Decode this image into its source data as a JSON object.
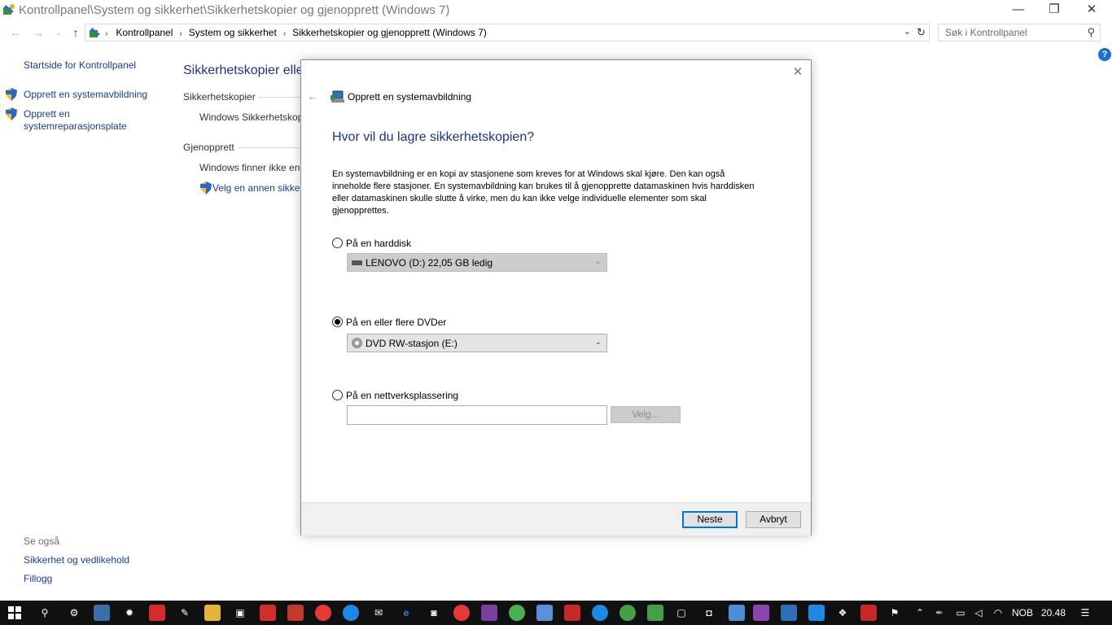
{
  "window": {
    "title": "Kontrollpanel\\System og sikkerhet\\Sikkerhetskopier og gjenopprett (Windows 7)",
    "minimize": "—",
    "maximize": "❐",
    "close": "✕"
  },
  "address": {
    "crumbs": [
      "Kontrollpanel",
      "System og sikkerhet",
      "Sikkerhetskopier og gjenopprett (Windows 7)"
    ],
    "search_placeholder": "Søk i Kontrollpanel"
  },
  "sidebar": {
    "home": "Startside for Kontrollpanel",
    "items": [
      {
        "label": "Opprett en systemavbildning"
      },
      {
        "label": "Opprett en systemreparasjonsplate",
        "line1": "Opprett en",
        "line2": "systemreparasjonsplate"
      }
    ],
    "see_also": "Se også",
    "see_also_items": [
      "Sikkerhet og vedlikehold",
      "Fillogg"
    ]
  },
  "main": {
    "title": "Sikkerhetskopier elle",
    "backup_section": "Sikkerhetskopier",
    "backup_text": "Windows Sikkerhetskop",
    "restore_section": "Gjenopprett",
    "restore_text": "Windows finner ikke en",
    "restore_link": "Velg en annen sikker"
  },
  "dialog": {
    "title": "Opprett en systemavbildning",
    "heading": "Hvor vil du lagre sikkerhetskopien?",
    "description": "En systemavbildning er en kopi av stasjonene som kreves for at Windows skal kjøre. Den kan også inneholde flere stasjoner. En systemavbildning kan brukes til å gjenopprette datamaskinen hvis harddisken eller datamaskinen skulle slutte å virke, men du kan ikke velge individuelle elementer som skal gjenopprettes.",
    "options": {
      "harddisk": {
        "label": "På en harddisk",
        "selected": false,
        "combo_value": "LENOVO (D:)  22,05 GB ledig"
      },
      "dvd": {
        "label": "På en eller flere DVDer",
        "selected": true,
        "combo_value": "DVD RW-stasjon (E:)"
      },
      "network": {
        "label": "På en nettverksplassering",
        "selected": false,
        "path_value": "",
        "choose_button": "Velg..."
      }
    },
    "next_button": "Neste",
    "cancel_button": "Avbryt"
  },
  "taskbar": {
    "language": "NOB",
    "time": "20.48"
  }
}
